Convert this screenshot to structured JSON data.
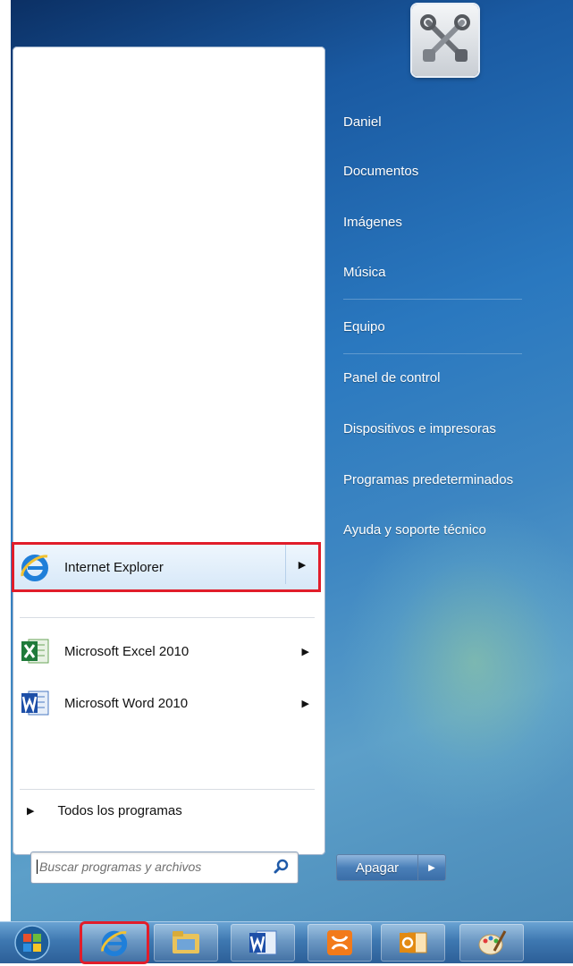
{
  "right_panel": {
    "items": [
      {
        "label": "Daniel"
      },
      {
        "label": "Documentos"
      },
      {
        "label": "Imágenes"
      },
      {
        "label": "Música"
      },
      {
        "label": "Equipo"
      },
      {
        "label": "Panel de control"
      },
      {
        "label": "Dispositivos e impresoras"
      },
      {
        "label": "Programas predeterminados"
      },
      {
        "label": "Ayuda y soporte técnico"
      }
    ],
    "user_picture_icon": "tools-icon"
  },
  "left_panel": {
    "pinned": [
      {
        "label": "Internet Explorer",
        "icon": "internet-explorer-icon",
        "highlighted": true
      }
    ],
    "recent": [
      {
        "label": "Microsoft Excel 2010",
        "icon": "excel-icon"
      },
      {
        "label": "Microsoft Word 2010",
        "icon": "word-icon"
      }
    ],
    "all_programs": "Todos los programas"
  },
  "search": {
    "placeholder": "Buscar programas y archivos"
  },
  "shutdown": {
    "label": "Apagar"
  },
  "taskbar": {
    "items": [
      {
        "icon": "start-orb-icon"
      },
      {
        "icon": "internet-explorer-icon",
        "highlighted": true
      },
      {
        "icon": "file-explorer-icon"
      },
      {
        "icon": "word-icon"
      },
      {
        "icon": "xampp-icon"
      },
      {
        "icon": "outlook-icon"
      },
      {
        "icon": "paint-icon"
      }
    ]
  },
  "colors": {
    "highlight_border": "#e11d2a",
    "menu_blue": "#2a78bf"
  }
}
